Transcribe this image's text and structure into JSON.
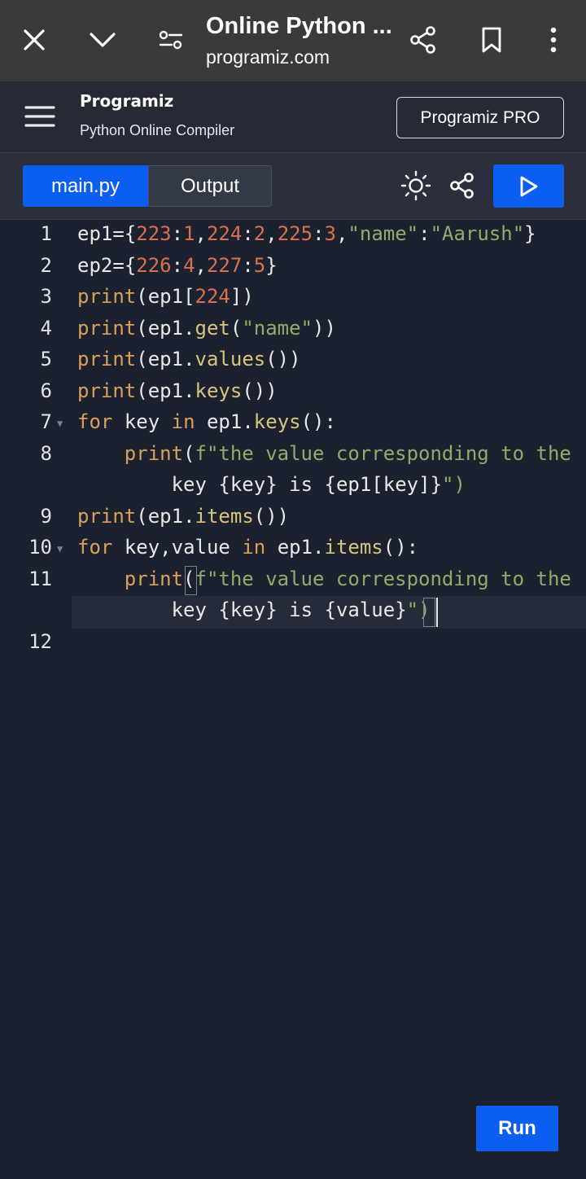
{
  "browser": {
    "title": "Online Python ...",
    "url": "programiz.com"
  },
  "header": {
    "logo": "Programiz",
    "subtitle": "Python Online Compiler",
    "pro_button": "Programiz PRO"
  },
  "toolbar": {
    "tabs": [
      {
        "label": "main.py",
        "active": true
      },
      {
        "label": "Output",
        "active": false
      }
    ]
  },
  "editor": {
    "line_numbers": [
      "1",
      "2",
      "3",
      "4",
      "5",
      "6",
      "7",
      "8",
      "9",
      "10",
      "11",
      "12"
    ],
    "lines": [
      "ep1={223:1,224:2,225:3,\"name\":\"Aarush\"}",
      "ep2={226:4,227:5}",
      "print(ep1[224])",
      "print(ep1.get(\"name\"))",
      "print(ep1.values())",
      "print(ep1.keys())",
      "for key in ep1.keys():",
      "    print(f\"the value corresponding to the",
      "        key {key} is {ep1[key]}\")",
      "print(ep1.items())",
      "for key,value in ep1.items():",
      "    print(f\"the value corresponding to the",
      "        key {key} is {value}\")"
    ]
  },
  "run_button": "Run",
  "colors": {
    "accent": "#0c5ef0",
    "editor_bg": "#1c2130",
    "keyword": "#d9a15a",
    "number": "#d9714e",
    "string": "#98a86a",
    "function": "#d8c47a"
  }
}
